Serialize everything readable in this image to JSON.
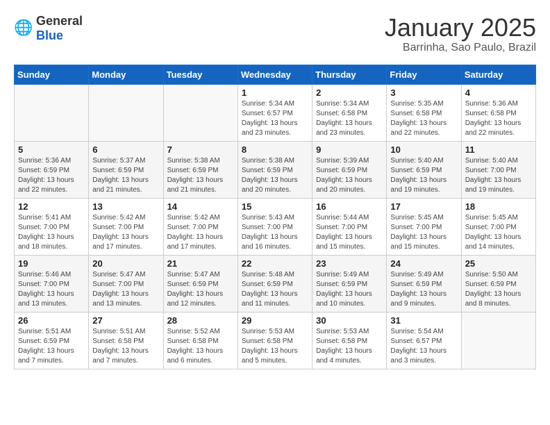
{
  "header": {
    "logo_general": "General",
    "logo_blue": "Blue",
    "title": "January 2025",
    "subtitle": "Barrinha, Sao Paulo, Brazil"
  },
  "days_of_week": [
    "Sunday",
    "Monday",
    "Tuesday",
    "Wednesday",
    "Thursday",
    "Friday",
    "Saturday"
  ],
  "weeks": [
    [
      {
        "day": "",
        "info": ""
      },
      {
        "day": "",
        "info": ""
      },
      {
        "day": "",
        "info": ""
      },
      {
        "day": "1",
        "info": "Sunrise: 5:34 AM\nSunset: 6:57 PM\nDaylight: 13 hours\nand 23 minutes."
      },
      {
        "day": "2",
        "info": "Sunrise: 5:34 AM\nSunset: 6:58 PM\nDaylight: 13 hours\nand 23 minutes."
      },
      {
        "day": "3",
        "info": "Sunrise: 5:35 AM\nSunset: 6:58 PM\nDaylight: 13 hours\nand 22 minutes."
      },
      {
        "day": "4",
        "info": "Sunrise: 5:36 AM\nSunset: 6:58 PM\nDaylight: 13 hours\nand 22 minutes."
      }
    ],
    [
      {
        "day": "5",
        "info": "Sunrise: 5:36 AM\nSunset: 6:59 PM\nDaylight: 13 hours\nand 22 minutes."
      },
      {
        "day": "6",
        "info": "Sunrise: 5:37 AM\nSunset: 6:59 PM\nDaylight: 13 hours\nand 21 minutes."
      },
      {
        "day": "7",
        "info": "Sunrise: 5:38 AM\nSunset: 6:59 PM\nDaylight: 13 hours\nand 21 minutes."
      },
      {
        "day": "8",
        "info": "Sunrise: 5:38 AM\nSunset: 6:59 PM\nDaylight: 13 hours\nand 20 minutes."
      },
      {
        "day": "9",
        "info": "Sunrise: 5:39 AM\nSunset: 6:59 PM\nDaylight: 13 hours\nand 20 minutes."
      },
      {
        "day": "10",
        "info": "Sunrise: 5:40 AM\nSunset: 6:59 PM\nDaylight: 13 hours\nand 19 minutes."
      },
      {
        "day": "11",
        "info": "Sunrise: 5:40 AM\nSunset: 7:00 PM\nDaylight: 13 hours\nand 19 minutes."
      }
    ],
    [
      {
        "day": "12",
        "info": "Sunrise: 5:41 AM\nSunset: 7:00 PM\nDaylight: 13 hours\nand 18 minutes."
      },
      {
        "day": "13",
        "info": "Sunrise: 5:42 AM\nSunset: 7:00 PM\nDaylight: 13 hours\nand 17 minutes."
      },
      {
        "day": "14",
        "info": "Sunrise: 5:42 AM\nSunset: 7:00 PM\nDaylight: 13 hours\nand 17 minutes."
      },
      {
        "day": "15",
        "info": "Sunrise: 5:43 AM\nSunset: 7:00 PM\nDaylight: 13 hours\nand 16 minutes."
      },
      {
        "day": "16",
        "info": "Sunrise: 5:44 AM\nSunset: 7:00 PM\nDaylight: 13 hours\nand 15 minutes."
      },
      {
        "day": "17",
        "info": "Sunrise: 5:45 AM\nSunset: 7:00 PM\nDaylight: 13 hours\nand 15 minutes."
      },
      {
        "day": "18",
        "info": "Sunrise: 5:45 AM\nSunset: 7:00 PM\nDaylight: 13 hours\nand 14 minutes."
      }
    ],
    [
      {
        "day": "19",
        "info": "Sunrise: 5:46 AM\nSunset: 7:00 PM\nDaylight: 13 hours\nand 13 minutes."
      },
      {
        "day": "20",
        "info": "Sunrise: 5:47 AM\nSunset: 7:00 PM\nDaylight: 13 hours\nand 13 minutes."
      },
      {
        "day": "21",
        "info": "Sunrise: 5:47 AM\nSunset: 6:59 PM\nDaylight: 13 hours\nand 12 minutes."
      },
      {
        "day": "22",
        "info": "Sunrise: 5:48 AM\nSunset: 6:59 PM\nDaylight: 13 hours\nand 11 minutes."
      },
      {
        "day": "23",
        "info": "Sunrise: 5:49 AM\nSunset: 6:59 PM\nDaylight: 13 hours\nand 10 minutes."
      },
      {
        "day": "24",
        "info": "Sunrise: 5:49 AM\nSunset: 6:59 PM\nDaylight: 13 hours\nand 9 minutes."
      },
      {
        "day": "25",
        "info": "Sunrise: 5:50 AM\nSunset: 6:59 PM\nDaylight: 13 hours\nand 8 minutes."
      }
    ],
    [
      {
        "day": "26",
        "info": "Sunrise: 5:51 AM\nSunset: 6:59 PM\nDaylight: 13 hours\nand 7 minutes."
      },
      {
        "day": "27",
        "info": "Sunrise: 5:51 AM\nSunset: 6:58 PM\nDaylight: 13 hours\nand 7 minutes."
      },
      {
        "day": "28",
        "info": "Sunrise: 5:52 AM\nSunset: 6:58 PM\nDaylight: 13 hours\nand 6 minutes."
      },
      {
        "day": "29",
        "info": "Sunrise: 5:53 AM\nSunset: 6:58 PM\nDaylight: 13 hours\nand 5 minutes."
      },
      {
        "day": "30",
        "info": "Sunrise: 5:53 AM\nSunset: 6:58 PM\nDaylight: 13 hours\nand 4 minutes."
      },
      {
        "day": "31",
        "info": "Sunrise: 5:54 AM\nSunset: 6:57 PM\nDaylight: 13 hours\nand 3 minutes."
      },
      {
        "day": "",
        "info": ""
      }
    ]
  ]
}
